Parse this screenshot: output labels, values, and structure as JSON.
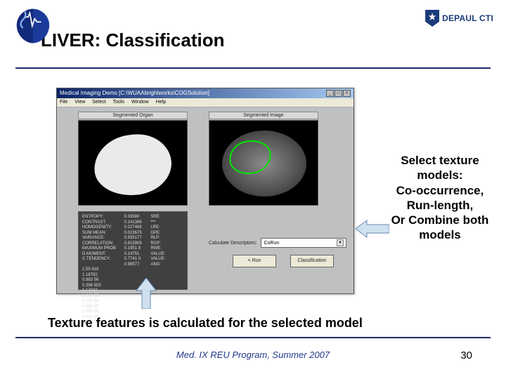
{
  "header": {
    "title": "LIVER: Classification",
    "brand": "DEPAUL CTI"
  },
  "app": {
    "titlebar": "Medical Imaging Demo   [C:\\WUAAbrightworks\\COGSolution]",
    "menu": [
      "File",
      "View",
      "Select",
      "Tools",
      "Window",
      "Help"
    ],
    "panel_left_label": "Segmented Organ",
    "panel_right_label": "Segmented Image",
    "stats": {
      "col1": [
        "ENTROPY:",
        "CONTRAST:",
        "",
        "HOMOGENITY:",
        "SUM MEAN:",
        "VARIANCE:",
        "",
        "CORRELATION:",
        "MAXIMUM PROB:",
        "D.MOMENT:",
        "C.TENDENCY:"
      ],
      "col2": [
        "0.33580",
        "0.141366",
        "0.227468",
        "",
        "0.023675",
        "0.935177",
        "0.815909",
        "",
        "0.1951 8",
        "0.14751",
        "0.7741 0",
        "0.98577"
      ],
      "col3": [
        "SRE:",
        "***",
        "LRE:",
        "",
        "GPE:",
        "RLP:",
        "RGP:",
        "",
        "RWE:",
        "VALUE:",
        "VALUE:",
        "ANG:"
      ],
      "col4": [
        "1.55 616",
        "1.18782",
        "0.983 56",
        "",
        "0.398 803",
        "1.12042",
        "0.248 25",
        "",
        "0.150 84",
        "0.886 60",
        "2.340 00",
        "0.041 50",
        "0.562 20"
      ]
    },
    "calc_label": "Calculate Descriptors:",
    "calc_value": "CoRun",
    "btn1": "< Run",
    "btn2": "Classification"
  },
  "callout": {
    "l1": "Select texture",
    "l2": "models:",
    "l3": "Co-occurrence,",
    "l4": "Run-length,",
    "l5": "Or Combine both",
    "l6": "models"
  },
  "bottom_text": "Texture features is calculated for the selected model",
  "footer": "Med. IX REU Program, Summer 2007",
  "page": "30"
}
